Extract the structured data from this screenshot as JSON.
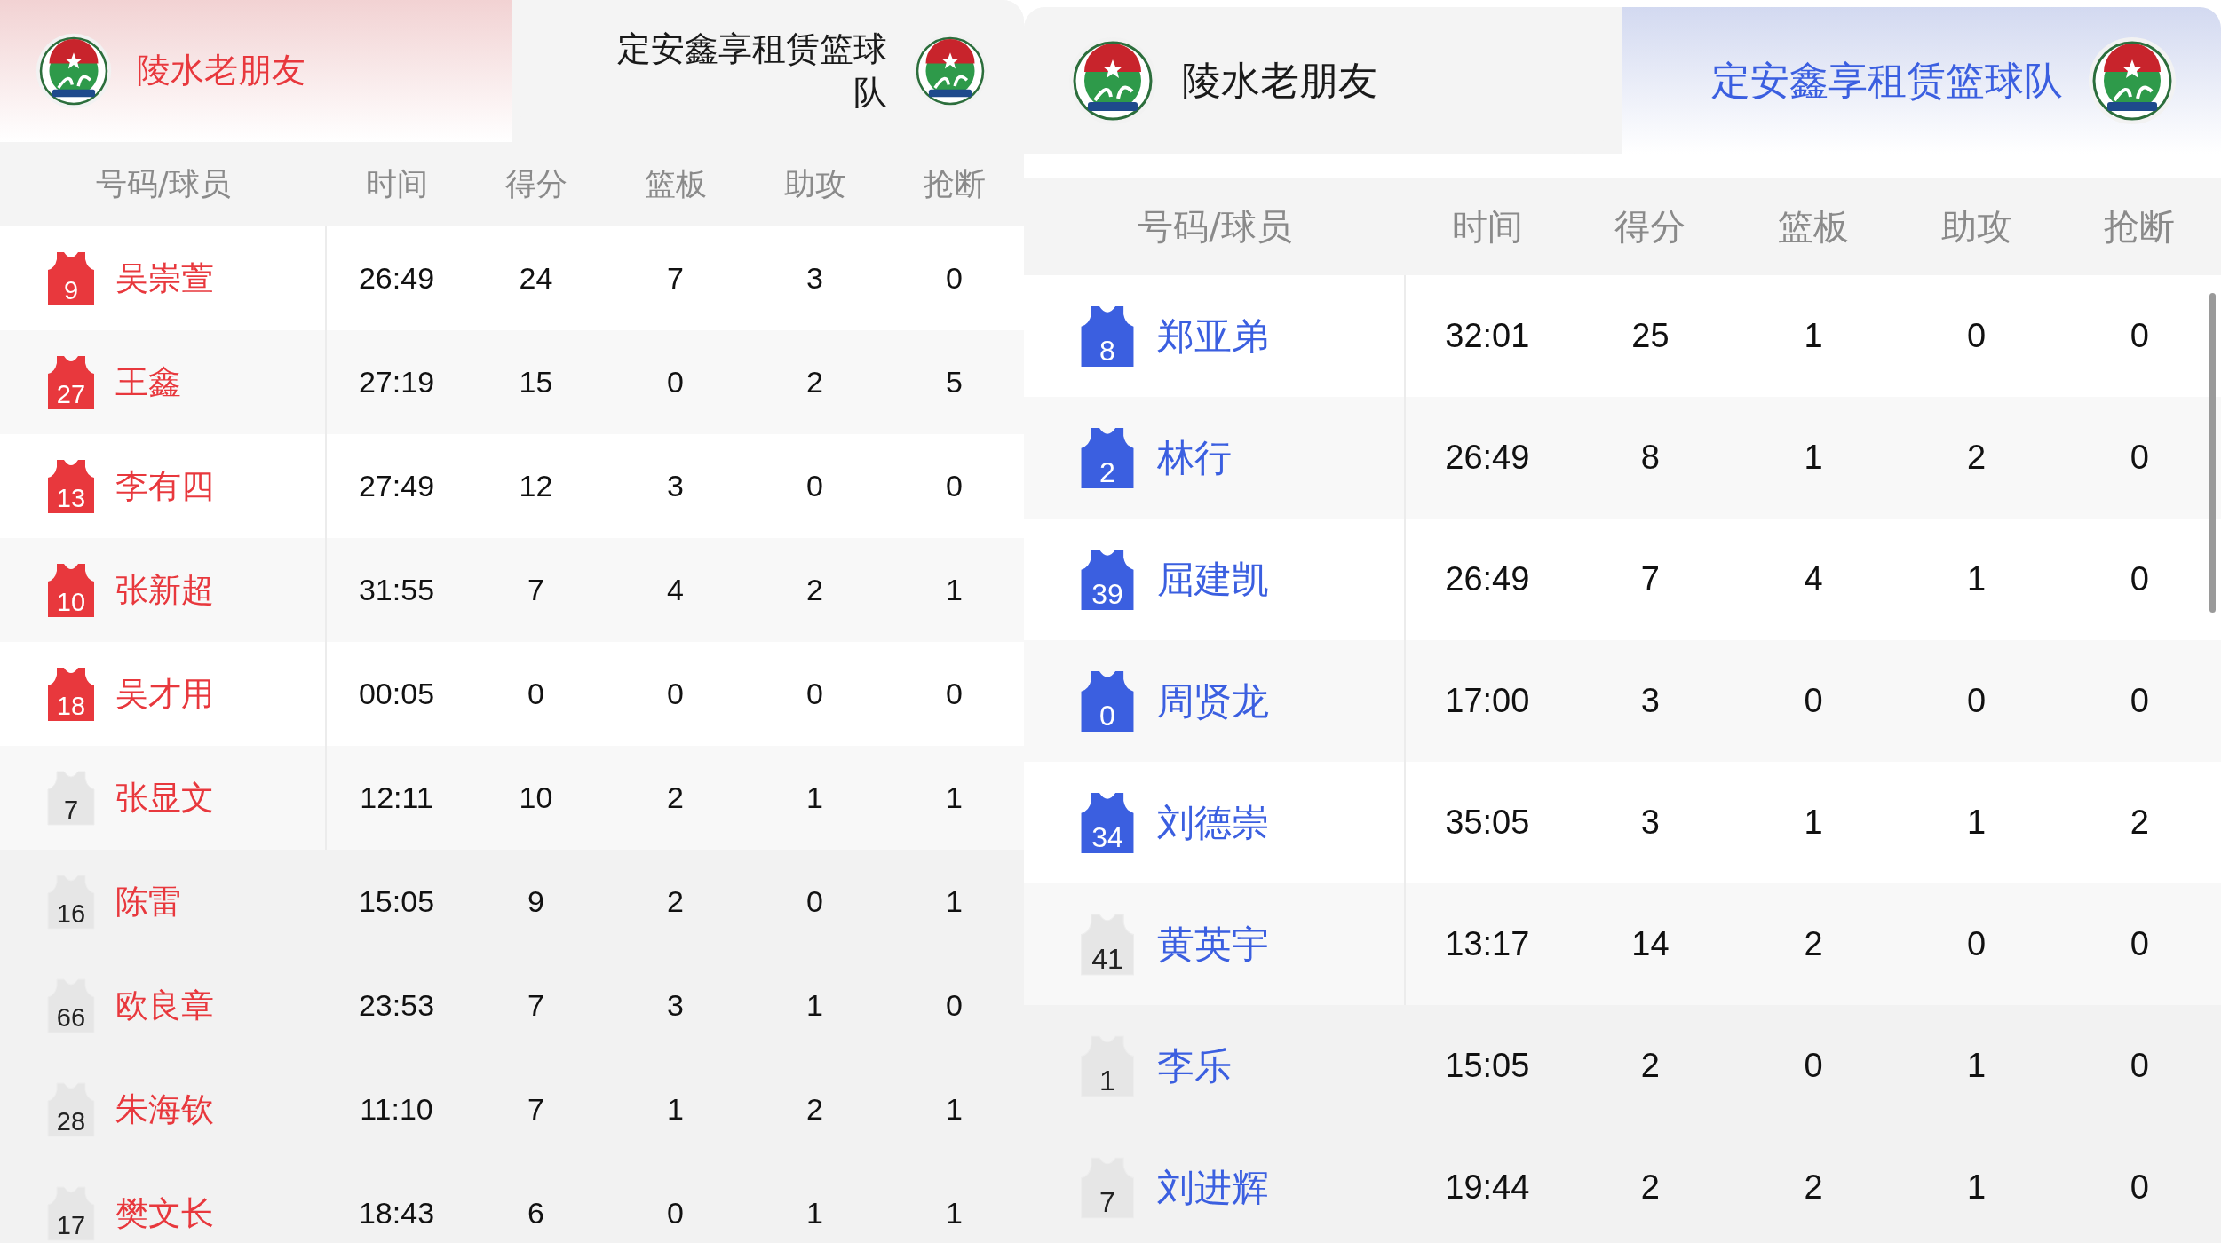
{
  "panels": [
    {
      "color": "#e8383d",
      "teams": [
        {
          "name": "陵水老朋友",
          "selected": true
        },
        {
          "name": "定安鑫享租赁篮球队",
          "selected": false
        }
      ],
      "columns": [
        "号码/球员",
        "时间",
        "得分",
        "篮板",
        "助攻",
        "抢断"
      ],
      "players": [
        {
          "number": "9",
          "name": "吴崇萱",
          "starter": true,
          "stats": [
            "26:49",
            "24",
            "7",
            "3",
            "0"
          ]
        },
        {
          "number": "27",
          "name": "王鑫",
          "starter": true,
          "stats": [
            "27:19",
            "15",
            "0",
            "2",
            "5"
          ]
        },
        {
          "number": "13",
          "name": "李有四",
          "starter": true,
          "stats": [
            "27:49",
            "12",
            "3",
            "0",
            "0"
          ]
        },
        {
          "number": "10",
          "name": "张新超",
          "starter": true,
          "stats": [
            "31:55",
            "7",
            "4",
            "2",
            "1"
          ]
        },
        {
          "number": "18",
          "name": "吴才用",
          "starter": true,
          "stats": [
            "00:05",
            "0",
            "0",
            "0",
            "0"
          ]
        },
        {
          "number": "7",
          "name": "张显文",
          "starter": false,
          "stats": [
            "12:11",
            "10",
            "2",
            "1",
            "1"
          ]
        },
        {
          "number": "16",
          "name": "陈雷",
          "starter": false,
          "stats": [
            "15:05",
            "9",
            "2",
            "0",
            "1"
          ]
        },
        {
          "number": "66",
          "name": "欧良章",
          "starter": false,
          "stats": [
            "23:53",
            "7",
            "3",
            "1",
            "0"
          ]
        },
        {
          "number": "28",
          "name": "朱海钦",
          "starter": false,
          "stats": [
            "11:10",
            "7",
            "1",
            "2",
            "1"
          ]
        },
        {
          "number": "17",
          "name": "樊文长",
          "starter": false,
          "stats": [
            "18:43",
            "6",
            "0",
            "1",
            "1"
          ]
        }
      ]
    },
    {
      "color": "#3b5fe0",
      "teams": [
        {
          "name": "陵水老朋友",
          "selected": false
        },
        {
          "name": "定安鑫享租赁篮球队",
          "selected": true
        }
      ],
      "columns": [
        "号码/球员",
        "时间",
        "得分",
        "篮板",
        "助攻",
        "抢断"
      ],
      "players": [
        {
          "number": "8",
          "name": "郑亚弟",
          "starter": true,
          "stats": [
            "32:01",
            "25",
            "1",
            "0",
            "0"
          ]
        },
        {
          "number": "2",
          "name": "林行",
          "starter": true,
          "stats": [
            "26:49",
            "8",
            "1",
            "2",
            "0"
          ]
        },
        {
          "number": "39",
          "name": "屈建凯",
          "starter": true,
          "stats": [
            "26:49",
            "7",
            "4",
            "1",
            "0"
          ]
        },
        {
          "number": "0",
          "name": "周贤龙",
          "starter": true,
          "stats": [
            "17:00",
            "3",
            "0",
            "0",
            "0"
          ]
        },
        {
          "number": "34",
          "name": "刘德崇",
          "starter": true,
          "stats": [
            "35:05",
            "3",
            "1",
            "1",
            "2"
          ]
        },
        {
          "number": "41",
          "name": "黄英宇",
          "starter": false,
          "stats": [
            "13:17",
            "14",
            "2",
            "0",
            "0"
          ]
        },
        {
          "number": "1",
          "name": "李乐",
          "starter": false,
          "stats": [
            "15:05",
            "2",
            "0",
            "1",
            "0"
          ]
        },
        {
          "number": "7",
          "name": "刘进辉",
          "starter": false,
          "stats": [
            "19:44",
            "2",
            "2",
            "1",
            "0"
          ]
        }
      ]
    }
  ]
}
